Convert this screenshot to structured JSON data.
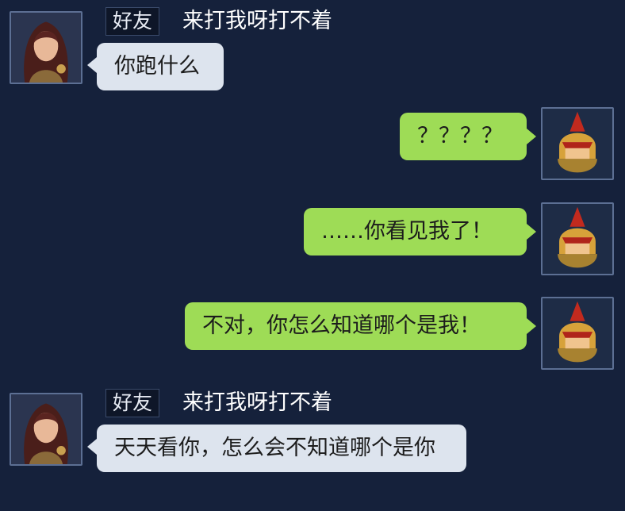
{
  "messages": [
    {
      "sender_tag": "好友",
      "sender_name": "来打我呀打不着",
      "text": "你跑什么",
      "direction": "incoming",
      "avatar_icon": "female-warrior-avatar-icon"
    },
    {
      "text": "？？？？",
      "direction": "outgoing",
      "avatar_icon": "golden-helmet-warrior-avatar-icon"
    },
    {
      "text": "……你看见我了！",
      "direction": "outgoing",
      "avatar_icon": "golden-helmet-warrior-avatar-icon"
    },
    {
      "text": "不对，你怎么知道哪个是我！",
      "direction": "outgoing",
      "avatar_icon": "golden-helmet-warrior-avatar-icon"
    },
    {
      "sender_tag": "好友",
      "sender_name": "来打我呀打不着",
      "text": "天天看你，怎么会不知道哪个是你",
      "direction": "incoming",
      "avatar_icon": "female-warrior-avatar-icon"
    }
  ],
  "colors": {
    "background": "#15213b",
    "incoming_bubble": "#dde4ee",
    "outgoing_bubble": "#9edc56"
  }
}
